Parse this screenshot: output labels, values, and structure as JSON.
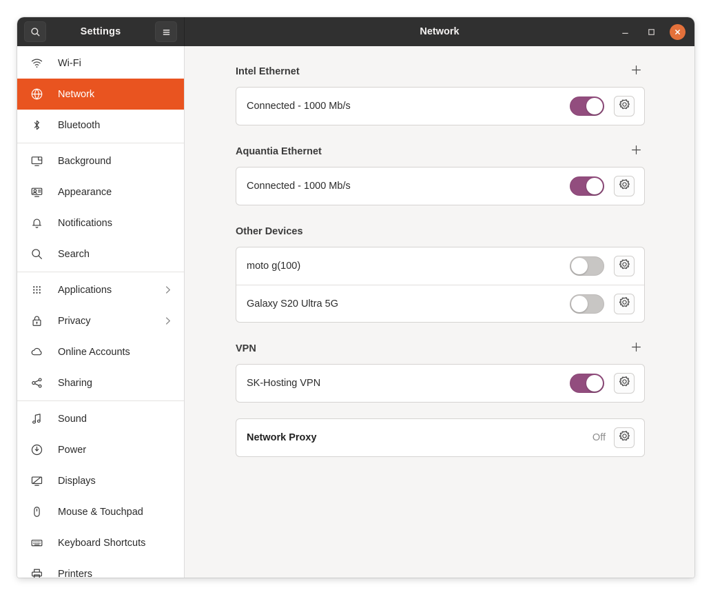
{
  "window": {
    "app_title": "Settings",
    "page_title": "Network",
    "search_icon": "search-icon",
    "menu_icon": "hamburger-menu-icon",
    "minimize_label": "–",
    "maximize_label": "□",
    "close_label": "×"
  },
  "sidebar": {
    "groups": [
      {
        "items": [
          {
            "label": "Wi-Fi",
            "icon": "wifi-icon",
            "active": false,
            "chevron": false
          },
          {
            "label": "Network",
            "icon": "globe-icon",
            "active": true,
            "chevron": false
          },
          {
            "label": "Bluetooth",
            "icon": "bluetooth-icon",
            "active": false,
            "chevron": false
          }
        ]
      },
      {
        "items": [
          {
            "label": "Background",
            "icon": "background-icon",
            "active": false,
            "chevron": false
          },
          {
            "label": "Appearance",
            "icon": "appearance-icon",
            "active": false,
            "chevron": false
          },
          {
            "label": "Notifications",
            "icon": "bell-icon",
            "active": false,
            "chevron": false
          },
          {
            "label": "Search",
            "icon": "search-icon",
            "active": false,
            "chevron": false
          }
        ]
      },
      {
        "items": [
          {
            "label": "Applications",
            "icon": "grid-dots-icon",
            "active": false,
            "chevron": true
          },
          {
            "label": "Privacy",
            "icon": "lock-icon",
            "active": false,
            "chevron": true
          },
          {
            "label": "Online Accounts",
            "icon": "cloud-icon",
            "active": false,
            "chevron": false
          },
          {
            "label": "Sharing",
            "icon": "share-icon",
            "active": false,
            "chevron": false
          }
        ]
      },
      {
        "items": [
          {
            "label": "Sound",
            "icon": "music-note-icon",
            "active": false,
            "chevron": false
          },
          {
            "label": "Power",
            "icon": "power-icon",
            "active": false,
            "chevron": false
          },
          {
            "label": "Displays",
            "icon": "display-icon",
            "active": false,
            "chevron": false
          },
          {
            "label": "Mouse & Touchpad",
            "icon": "mouse-icon",
            "active": false,
            "chevron": false
          },
          {
            "label": "Keyboard Shortcuts",
            "icon": "keyboard-icon",
            "active": false,
            "chevron": false
          },
          {
            "label": "Printers",
            "icon": "printer-icon",
            "active": false,
            "chevron": false
          }
        ]
      }
    ]
  },
  "main": {
    "sections": [
      {
        "title": "Intel Ethernet",
        "has_add": true,
        "add_label": "+",
        "rows": [
          {
            "label": "Connected - 1000 Mb/s",
            "bold": false,
            "toggle": "on",
            "status": null,
            "gear": true
          }
        ]
      },
      {
        "title": "Aquantia Ethernet",
        "has_add": true,
        "add_label": "+",
        "rows": [
          {
            "label": "Connected - 1000 Mb/s",
            "bold": false,
            "toggle": "on",
            "status": null,
            "gear": true
          }
        ]
      },
      {
        "title": "Other Devices",
        "has_add": false,
        "add_label": "",
        "rows": [
          {
            "label": "moto g(100)",
            "bold": false,
            "toggle": "off",
            "status": null,
            "gear": true
          },
          {
            "label": "Galaxy S20 Ultra 5G",
            "bold": false,
            "toggle": "off",
            "status": null,
            "gear": true
          }
        ]
      },
      {
        "title": "VPN",
        "has_add": true,
        "add_label": "+",
        "rows": [
          {
            "label": "SK-Hosting VPN",
            "bold": false,
            "toggle": "on",
            "status": null,
            "gear": true
          }
        ]
      },
      {
        "title": "",
        "has_add": false,
        "add_label": "",
        "rows": [
          {
            "label": "Network Proxy",
            "bold": true,
            "toggle": null,
            "status": "Off",
            "gear": true
          }
        ]
      }
    ]
  },
  "colors": {
    "accent": "#e95420",
    "toggle_on": "#924d7e",
    "toggle_off": "#c8c6c4",
    "headerbar": "#303030",
    "content_bg": "#f6f5f4",
    "close_button": "#e4713b"
  }
}
